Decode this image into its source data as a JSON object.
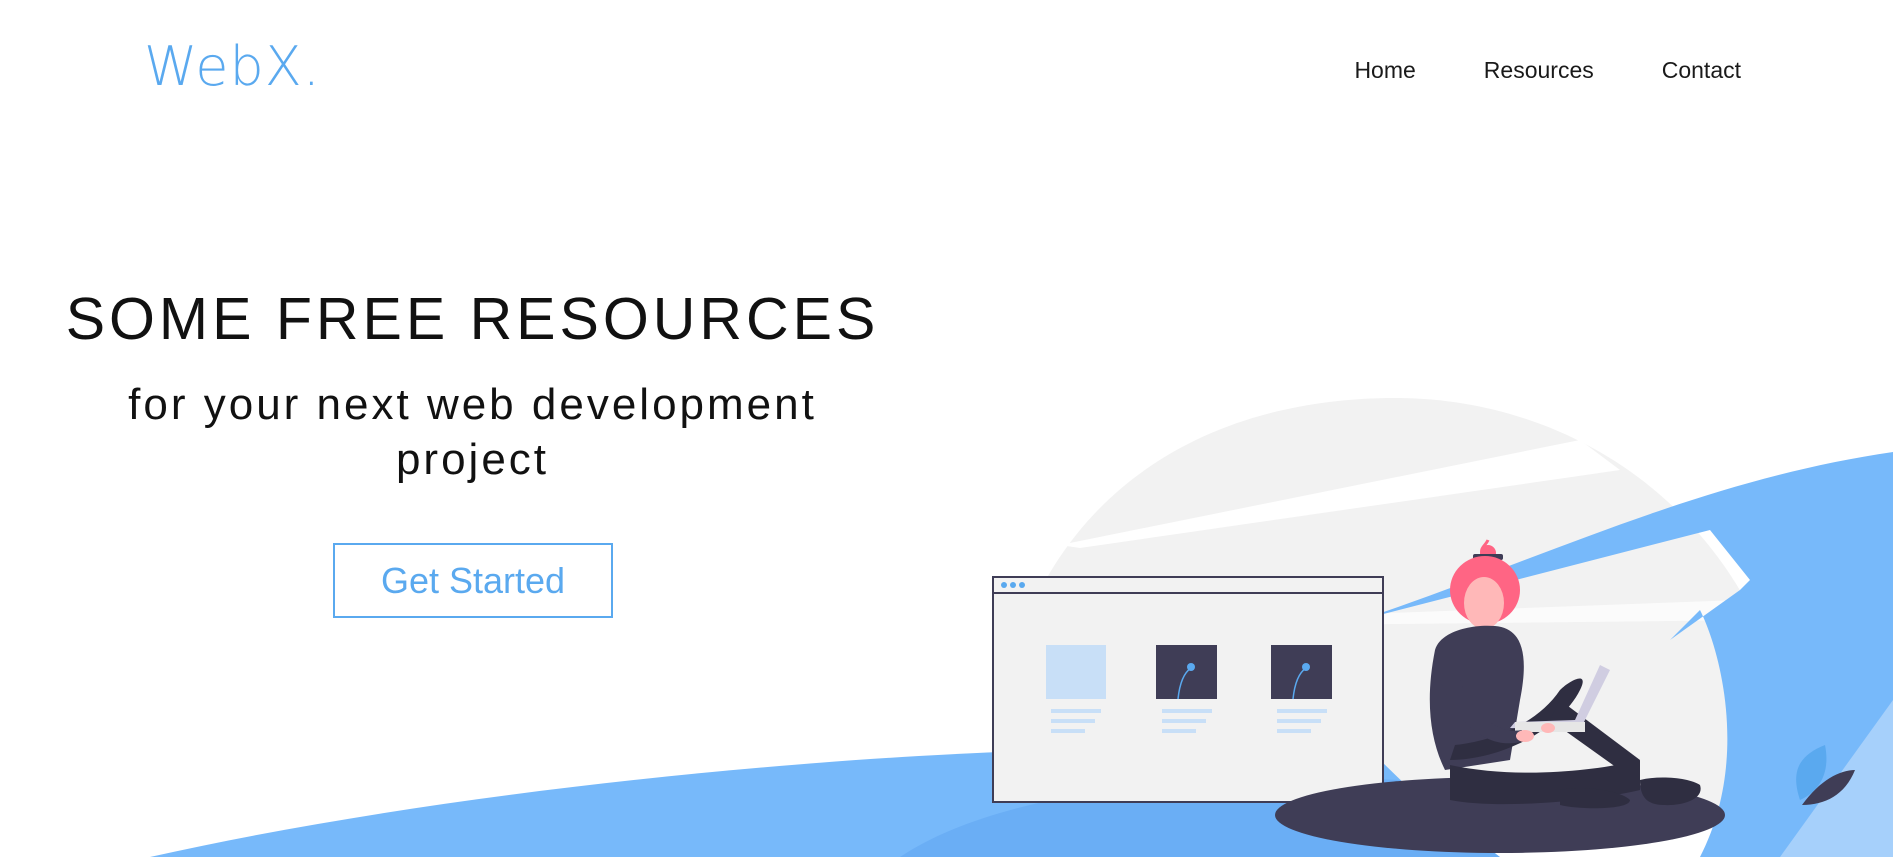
{
  "brand": {
    "logo_text": "WebX.",
    "color": "#5aa9ef"
  },
  "nav": {
    "items": [
      {
        "label": "Home"
      },
      {
        "label": "Resources"
      },
      {
        "label": "Contact"
      }
    ]
  },
  "hero": {
    "title": "SOME FREE RESOURCES",
    "subtitle": "for your next web development project",
    "cta_label": "Get Started"
  },
  "colors": {
    "accent": "#5aa9ef",
    "wave": "#77b9fa",
    "text": "#111111",
    "dark_figure": "#3f3d56",
    "hair": "#ff6584",
    "skin": "#ffb8b8"
  },
  "illustration": {
    "subject": "woman-with-laptop-and-browser-window"
  }
}
